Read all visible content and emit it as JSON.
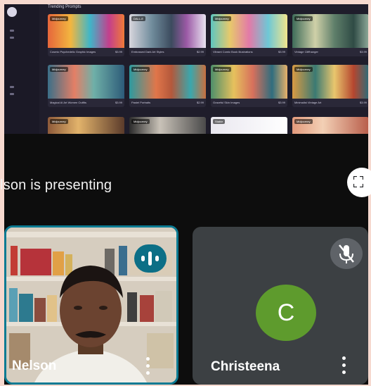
{
  "shared_screen": {
    "heading": "Trending Prompts",
    "cards": [
      {
        "tag": "Midjourney",
        "title": "Cosmic Psychedelic Graphic Images",
        "price": "$3.99"
      },
      {
        "tag": "DALL-E",
        "title": "Embossed Dark Art Styles",
        "price": "$2.99"
      },
      {
        "tag": "Midjourney",
        "title": "Vibrant Comic Book Illustrations",
        "price": "$3.99"
      },
      {
        "tag": "Midjourney",
        "title": "Vintage Cliffhanger",
        "price": "$3.99"
      },
      {
        "tag": "Midjourney",
        "title": "Magical AI Art Women Outfits",
        "price": "$3.99"
      },
      {
        "tag": "Midjourney",
        "title": "Pastel Portraits",
        "price": "$2.99"
      },
      {
        "tag": "Midjourney",
        "title": "Graceful Skin Images",
        "price": "$3.99"
      },
      {
        "tag": "Midjourney",
        "title": "Minimalist Vintage Art",
        "price": "$3.99"
      },
      {
        "tag": "Midjourney",
        "title": "",
        "price": ""
      },
      {
        "tag": "Midjourney",
        "title": "",
        "price": ""
      },
      {
        "tag": "Stable",
        "title": "",
        "price": ""
      },
      {
        "tag": "Midjourney",
        "title": "",
        "price": ""
      }
    ]
  },
  "presenting": {
    "text": "lson is presenting"
  },
  "participants": [
    {
      "name": "Nelson",
      "speaking": true
    },
    {
      "name": "Christeena",
      "initial": "C",
      "muted": true
    }
  ],
  "colors": {
    "accent": "#0c7b93",
    "avatar": "#5e9b2d",
    "tile": "#3c4043"
  }
}
